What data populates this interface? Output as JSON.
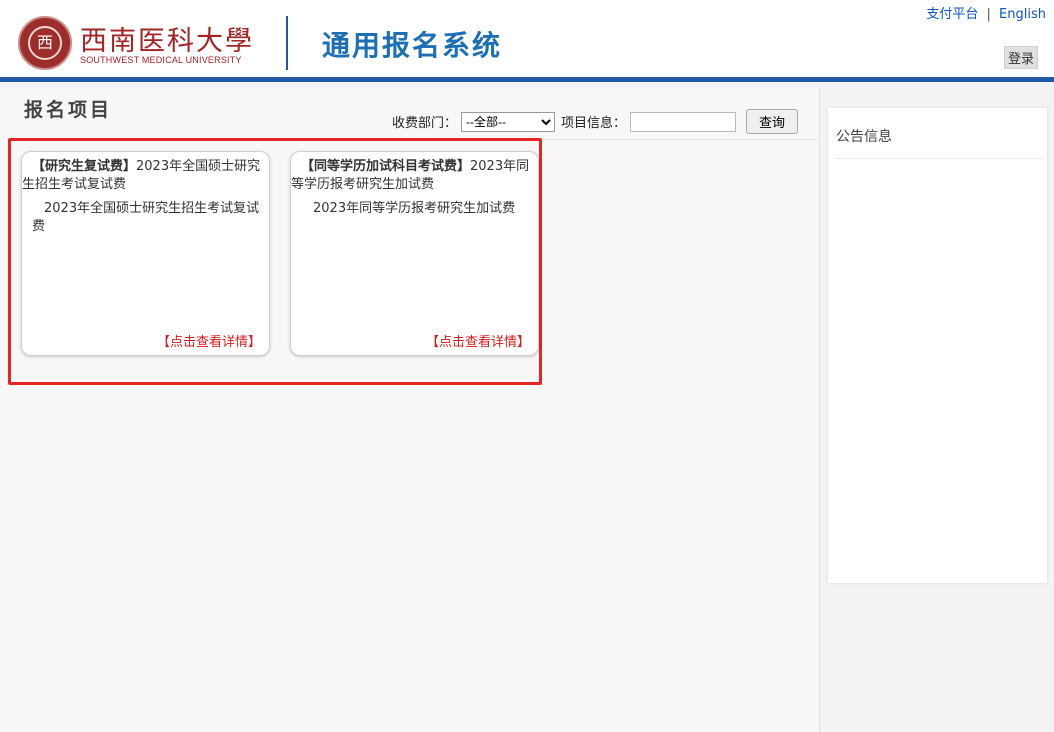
{
  "header": {
    "seal_char": "西",
    "university_cn": "西南医科大學",
    "university_en": "SOUTHWEST MEDICAL UNIVERSITY",
    "system_title": "通用报名系统",
    "links": {
      "pay": "支付平台",
      "separator": "|",
      "english": "English"
    },
    "login_label": "登录"
  },
  "main": {
    "section_title": "报名项目",
    "filter": {
      "department_label": "收费部门：",
      "department_selected": "--全部--",
      "info_label": "项目信息：",
      "info_value": "",
      "search_label": "查询"
    },
    "cards": [
      {
        "tag": "【研究生复试费】",
        "title": "2023年全国硕士研究生招生考试复试费",
        "description": "2023年全国硕士研究生招生考试复试费",
        "link": "【点击查看详情】"
      },
      {
        "tag": "【同等学历加试科目考试费】",
        "title": "2023年同等学历报考研究生加试费",
        "description": "2023年同等学历报考研究生加试费",
        "link": "【点击查看详情】"
      }
    ]
  },
  "notice": {
    "title": "公告信息"
  },
  "colors": {
    "brand_blue": "#1f5aa6",
    "title_blue": "#1c6fb5",
    "university_red": "#a32222",
    "highlight_red": "#e52424",
    "link_red": "#d41c1c"
  }
}
